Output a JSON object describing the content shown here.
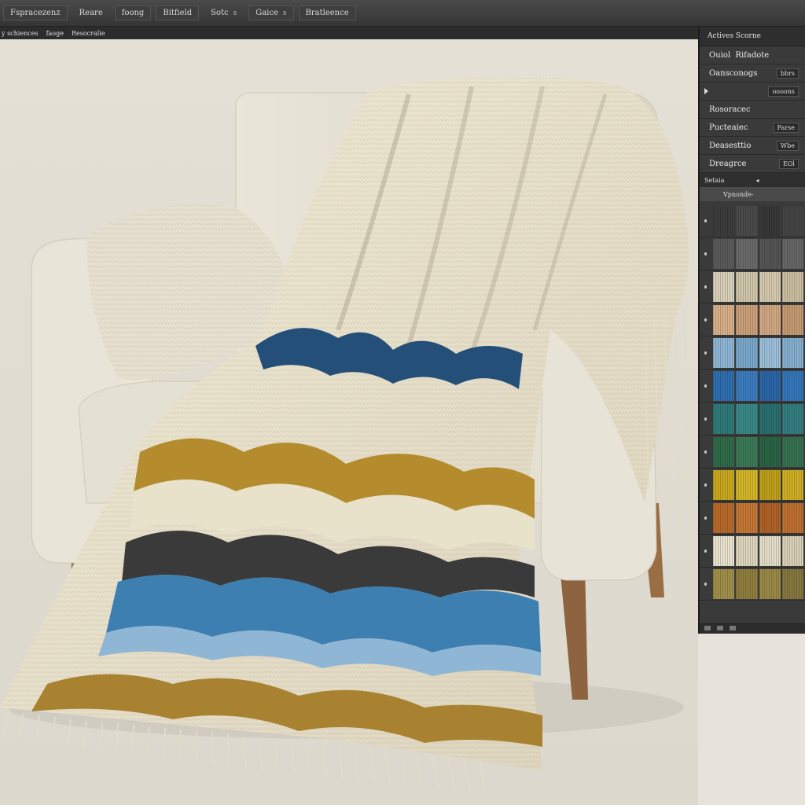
{
  "menu": {
    "items": [
      "Fspracezenz",
      "Reare",
      "foong",
      "Bitfield",
      "Sotc",
      "Gaice",
      "Bratleence"
    ],
    "symbols": [
      "s",
      "s"
    ]
  },
  "toolbar2": {
    "items": [
      "y schiences",
      "faoge",
      "Resocralie"
    ]
  },
  "panel": {
    "title": "Actives Scorne",
    "rows": [
      {
        "label": "Ouiol",
        "value": "Rifadote"
      },
      {
        "label": "Oansconogs",
        "value": "bbrs"
      },
      {
        "label": "",
        "value": "oooons"
      },
      {
        "label": "Rosoracec",
        "value": ""
      },
      {
        "label": "Pucteaiec",
        "value": "Parse"
      },
      {
        "label": "Deasesttio",
        "value": "Wbe"
      },
      {
        "label": "Dreagrce",
        "value": "EOl"
      }
    ],
    "swatches_header": "Setaia",
    "swatches_search": "Vpnonde-",
    "swatch_colors": [
      [
        "#3c3c3c",
        "#4a4a4a",
        "#383838",
        "#444444"
      ],
      [
        "#5a5a5a",
        "#6a6a6a",
        "#555555",
        "#666666"
      ],
      [
        "#d8d0b8",
        "#cfc6aa",
        "#d4c9ad",
        "#c9bfa0"
      ],
      [
        "#d9b08a",
        "#caa07a",
        "#d2a884",
        "#c49a72"
      ],
      [
        "#8fb6d4",
        "#7aa8cc",
        "#9cc0da",
        "#85b0d0"
      ],
      [
        "#2e6fb0",
        "#3a7cc0",
        "#2a66a8",
        "#3476ba"
      ],
      [
        "#2f7a7a",
        "#3a8888",
        "#2a7070",
        "#347e80"
      ],
      [
        "#2f6b4a",
        "#3a7a56",
        "#2a6444",
        "#347250"
      ],
      [
        "#c9a81f",
        "#d4b428",
        "#bfa01a",
        "#cfae24"
      ],
      [
        "#b86a2a",
        "#c47834",
        "#b06226",
        "#be7030"
      ],
      [
        "#e8e2cf",
        "#ddd5bd",
        "#e4ddc8",
        "#d8cfb5"
      ],
      [
        "#a08f4a",
        "#8f7f3e",
        "#9a8a46",
        "#877840"
      ]
    ]
  },
  "scene": {
    "chair_color": "#e6e2d5",
    "throw_base": "#ece6d2",
    "stripe_colors": [
      "#1f5a8a",
      "#b48c2e",
      "#333333",
      "#3c7fb0",
      "#a88230"
    ],
    "leg_color": "#9a6e45"
  }
}
